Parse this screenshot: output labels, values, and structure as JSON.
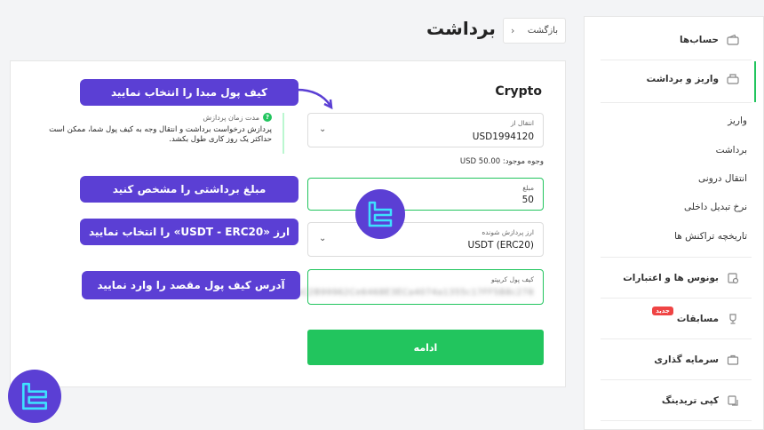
{
  "header": {
    "title": "برداشت",
    "back_label": "بازگشت"
  },
  "sidebar": {
    "accounts": "حساب‌ها",
    "deposit_withdraw": "واریز و برداشت",
    "sub_items": [
      "واریز",
      "برداشت",
      "انتقال درونی",
      "نرخ تبدیل داخلی",
      "تاریخچه تراکنش ها"
    ],
    "bonus": "بونوس ها و اعتبارات",
    "contests": "مسابقات",
    "new_badge": "جدید",
    "investment": "سرمایه گذاری",
    "copy_trading": "کپی تریدینگ"
  },
  "form": {
    "title": "Crypto",
    "from_label": "انتقال از",
    "from_value": "USD1994120",
    "balance": "وجوه موجود: 50.00 USD",
    "amount_label": "مبلغ",
    "amount_value": "50",
    "currency_label": "ارز پردازش شونده",
    "currency_value": "USDT (ERC20)",
    "wallet_label": "کیف پول کریپتو",
    "wallet_value": "0xC2B99962Ce6468E3ECa4074a1355c17FF5B8c278",
    "continue": "ادامه"
  },
  "info": {
    "heading": "مدت زمان پردازش",
    "text": "پردازش درخواست برداشت و انتقال وجه به کیف پول شما، ممکن است حداکثر یک روز کاری طول بکشد."
  },
  "callouts": {
    "source_wallet": "کیف پول مبدا را انتخاب نمایید",
    "amount": "مبلغ برداشتی را مشخص کنید",
    "currency": "ارز «USDT - ERC20» را انتخاب نمایید",
    "destination": "آدرس کیف پول مقصد را وارد نمایید"
  },
  "colors": {
    "accent": "#22c55e",
    "callout": "#5b3fd4",
    "logo_cyan": "#3ee0ff"
  },
  "icons": [
    "chevron-left-icon",
    "chevron-down-icon",
    "question-icon",
    "wallet-icon",
    "deposit-icon",
    "bonus-icon",
    "trophy-icon",
    "briefcase-icon",
    "copy-trading-icon",
    "logo-icon"
  ]
}
